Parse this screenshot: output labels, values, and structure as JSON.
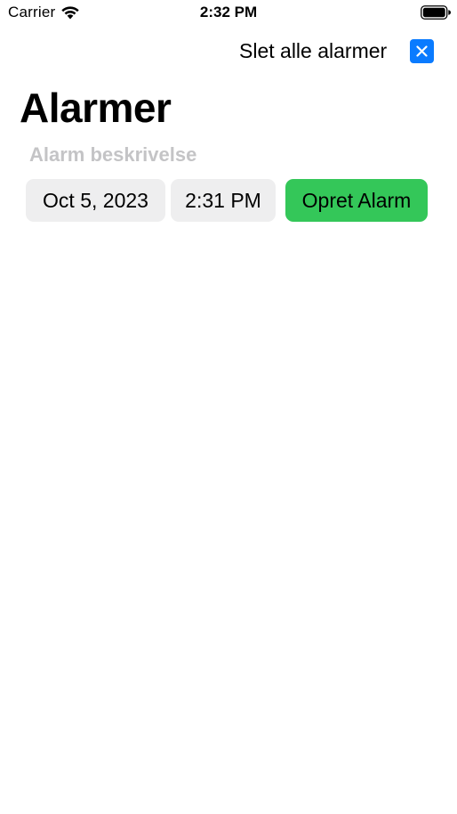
{
  "status_bar": {
    "carrier": "Carrier",
    "time": "2:32 PM",
    "wifi_icon": "wifi-icon",
    "battery_icon": "battery-icon"
  },
  "header": {
    "delete_all_label": "Slet alle alarmer",
    "close_icon": "close-icon",
    "close_color": "#0a7bff"
  },
  "title": "Alarmer",
  "form": {
    "description_placeholder": "Alarm beskrivelse",
    "description_value": "",
    "date": "Oct 5, 2023",
    "time": "2:31 PM",
    "create_label": "Opret Alarm",
    "create_color": "#34c759"
  }
}
